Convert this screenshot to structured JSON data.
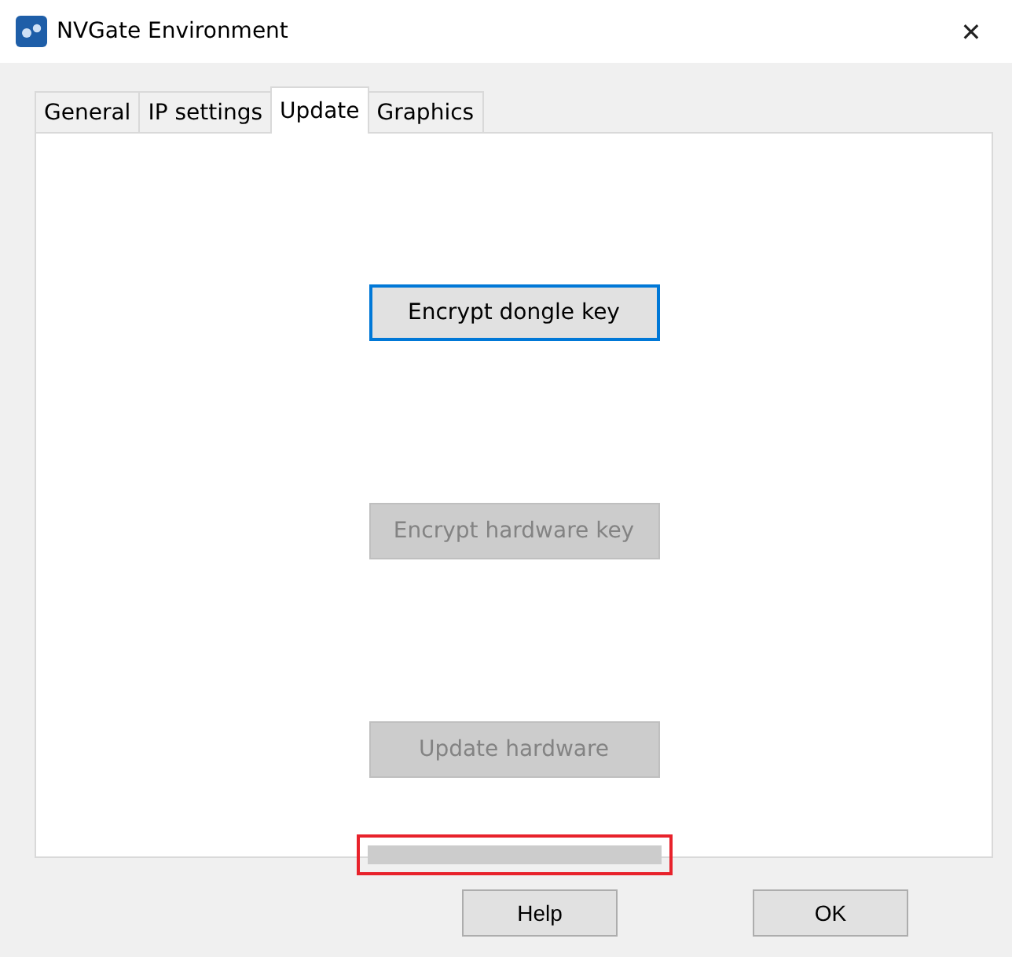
{
  "window": {
    "title": "NVGate Environment",
    "close": "✕"
  },
  "tabs": [
    {
      "label": "General",
      "selected": false
    },
    {
      "label": "IP settings",
      "selected": false
    },
    {
      "label": "Update",
      "selected": true
    },
    {
      "label": "Graphics",
      "selected": false
    }
  ],
  "actions": [
    {
      "label": "Encrypt dongle key",
      "disabled": false,
      "focused": true
    },
    {
      "label": "Encrypt hardware key",
      "disabled": true,
      "focused": false
    },
    {
      "label": "Update hardware",
      "disabled": true,
      "focused": false
    }
  ],
  "progress": {
    "level": 0,
    "highlighted": true
  },
  "buttons": [
    "Help",
    "OK"
  ]
}
